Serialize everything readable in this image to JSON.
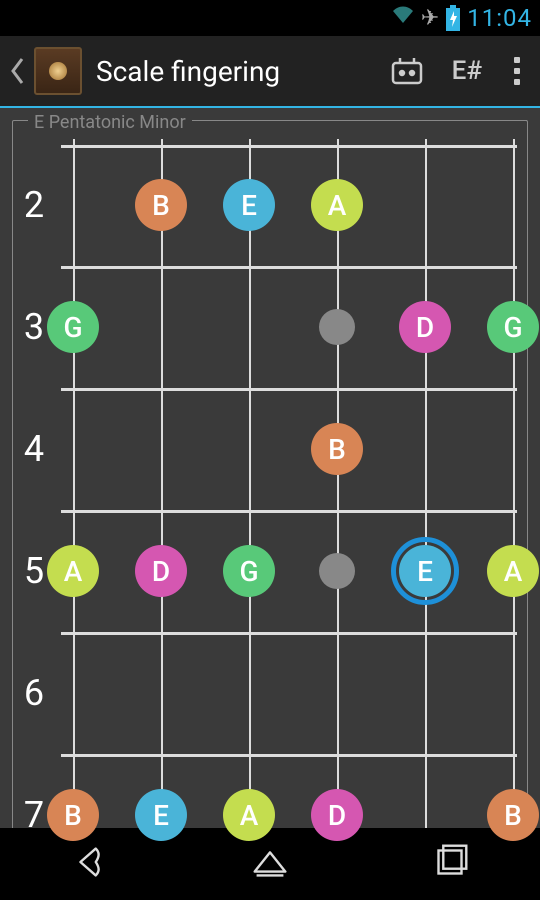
{
  "status": {
    "time": "11:04"
  },
  "header": {
    "title": "Scale fingering",
    "enharmonic_label": "E#"
  },
  "scale": {
    "name": "E Pentatonic Minor",
    "fret_numbers": [
      "2",
      "3",
      "4",
      "5",
      "6",
      "7"
    ],
    "strings": 6,
    "string_positions": [
      60,
      148,
      236,
      324,
      412,
      500
    ],
    "fret_row_centers": [
      66,
      188,
      310,
      432,
      554,
      676
    ],
    "fret_line_positions": [
      6,
      127,
      249,
      371,
      493,
      615
    ],
    "inlays": [
      {
        "string": 3,
        "fret_row": 1
      },
      {
        "string": 3,
        "fret_row": 3
      },
      {
        "string": 2,
        "fret_row": 5
      },
      {
        "string": 3,
        "fret_row": 5
      }
    ],
    "notes": [
      {
        "label": "B",
        "string": 1,
        "fret_row": 0,
        "color": "c-orange"
      },
      {
        "label": "E",
        "string": 2,
        "fret_row": 0,
        "color": "c-blue"
      },
      {
        "label": "A",
        "string": 3,
        "fret_row": 0,
        "color": "c-yellow"
      },
      {
        "label": "G",
        "string": 0,
        "fret_row": 1,
        "color": "c-green"
      },
      {
        "label": "D",
        "string": 4,
        "fret_row": 1,
        "color": "c-pink"
      },
      {
        "label": "G",
        "string": 5,
        "fret_row": 1,
        "color": "c-green"
      },
      {
        "label": "B",
        "string": 3,
        "fret_row": 2,
        "color": "c-orange"
      },
      {
        "label": "A",
        "string": 0,
        "fret_row": 3,
        "color": "c-yellow"
      },
      {
        "label": "D",
        "string": 1,
        "fret_row": 3,
        "color": "c-pink"
      },
      {
        "label": "G",
        "string": 2,
        "fret_row": 3,
        "color": "c-green"
      },
      {
        "label": "E",
        "string": 4,
        "fret_row": 3,
        "color": "c-blue",
        "highlight": true
      },
      {
        "label": "A",
        "string": 5,
        "fret_row": 3,
        "color": "c-yellow"
      },
      {
        "label": "B",
        "string": 0,
        "fret_row": 5,
        "color": "c-orange"
      },
      {
        "label": "E",
        "string": 1,
        "fret_row": 5,
        "color": "c-blue"
      },
      {
        "label": "A",
        "string": 2,
        "fret_row": 5,
        "color": "c-yellow"
      },
      {
        "label": "D",
        "string": 3,
        "fret_row": 5,
        "color": "c-pink"
      },
      {
        "label": "B",
        "string": 5,
        "fret_row": 5,
        "color": "c-orange"
      }
    ]
  }
}
